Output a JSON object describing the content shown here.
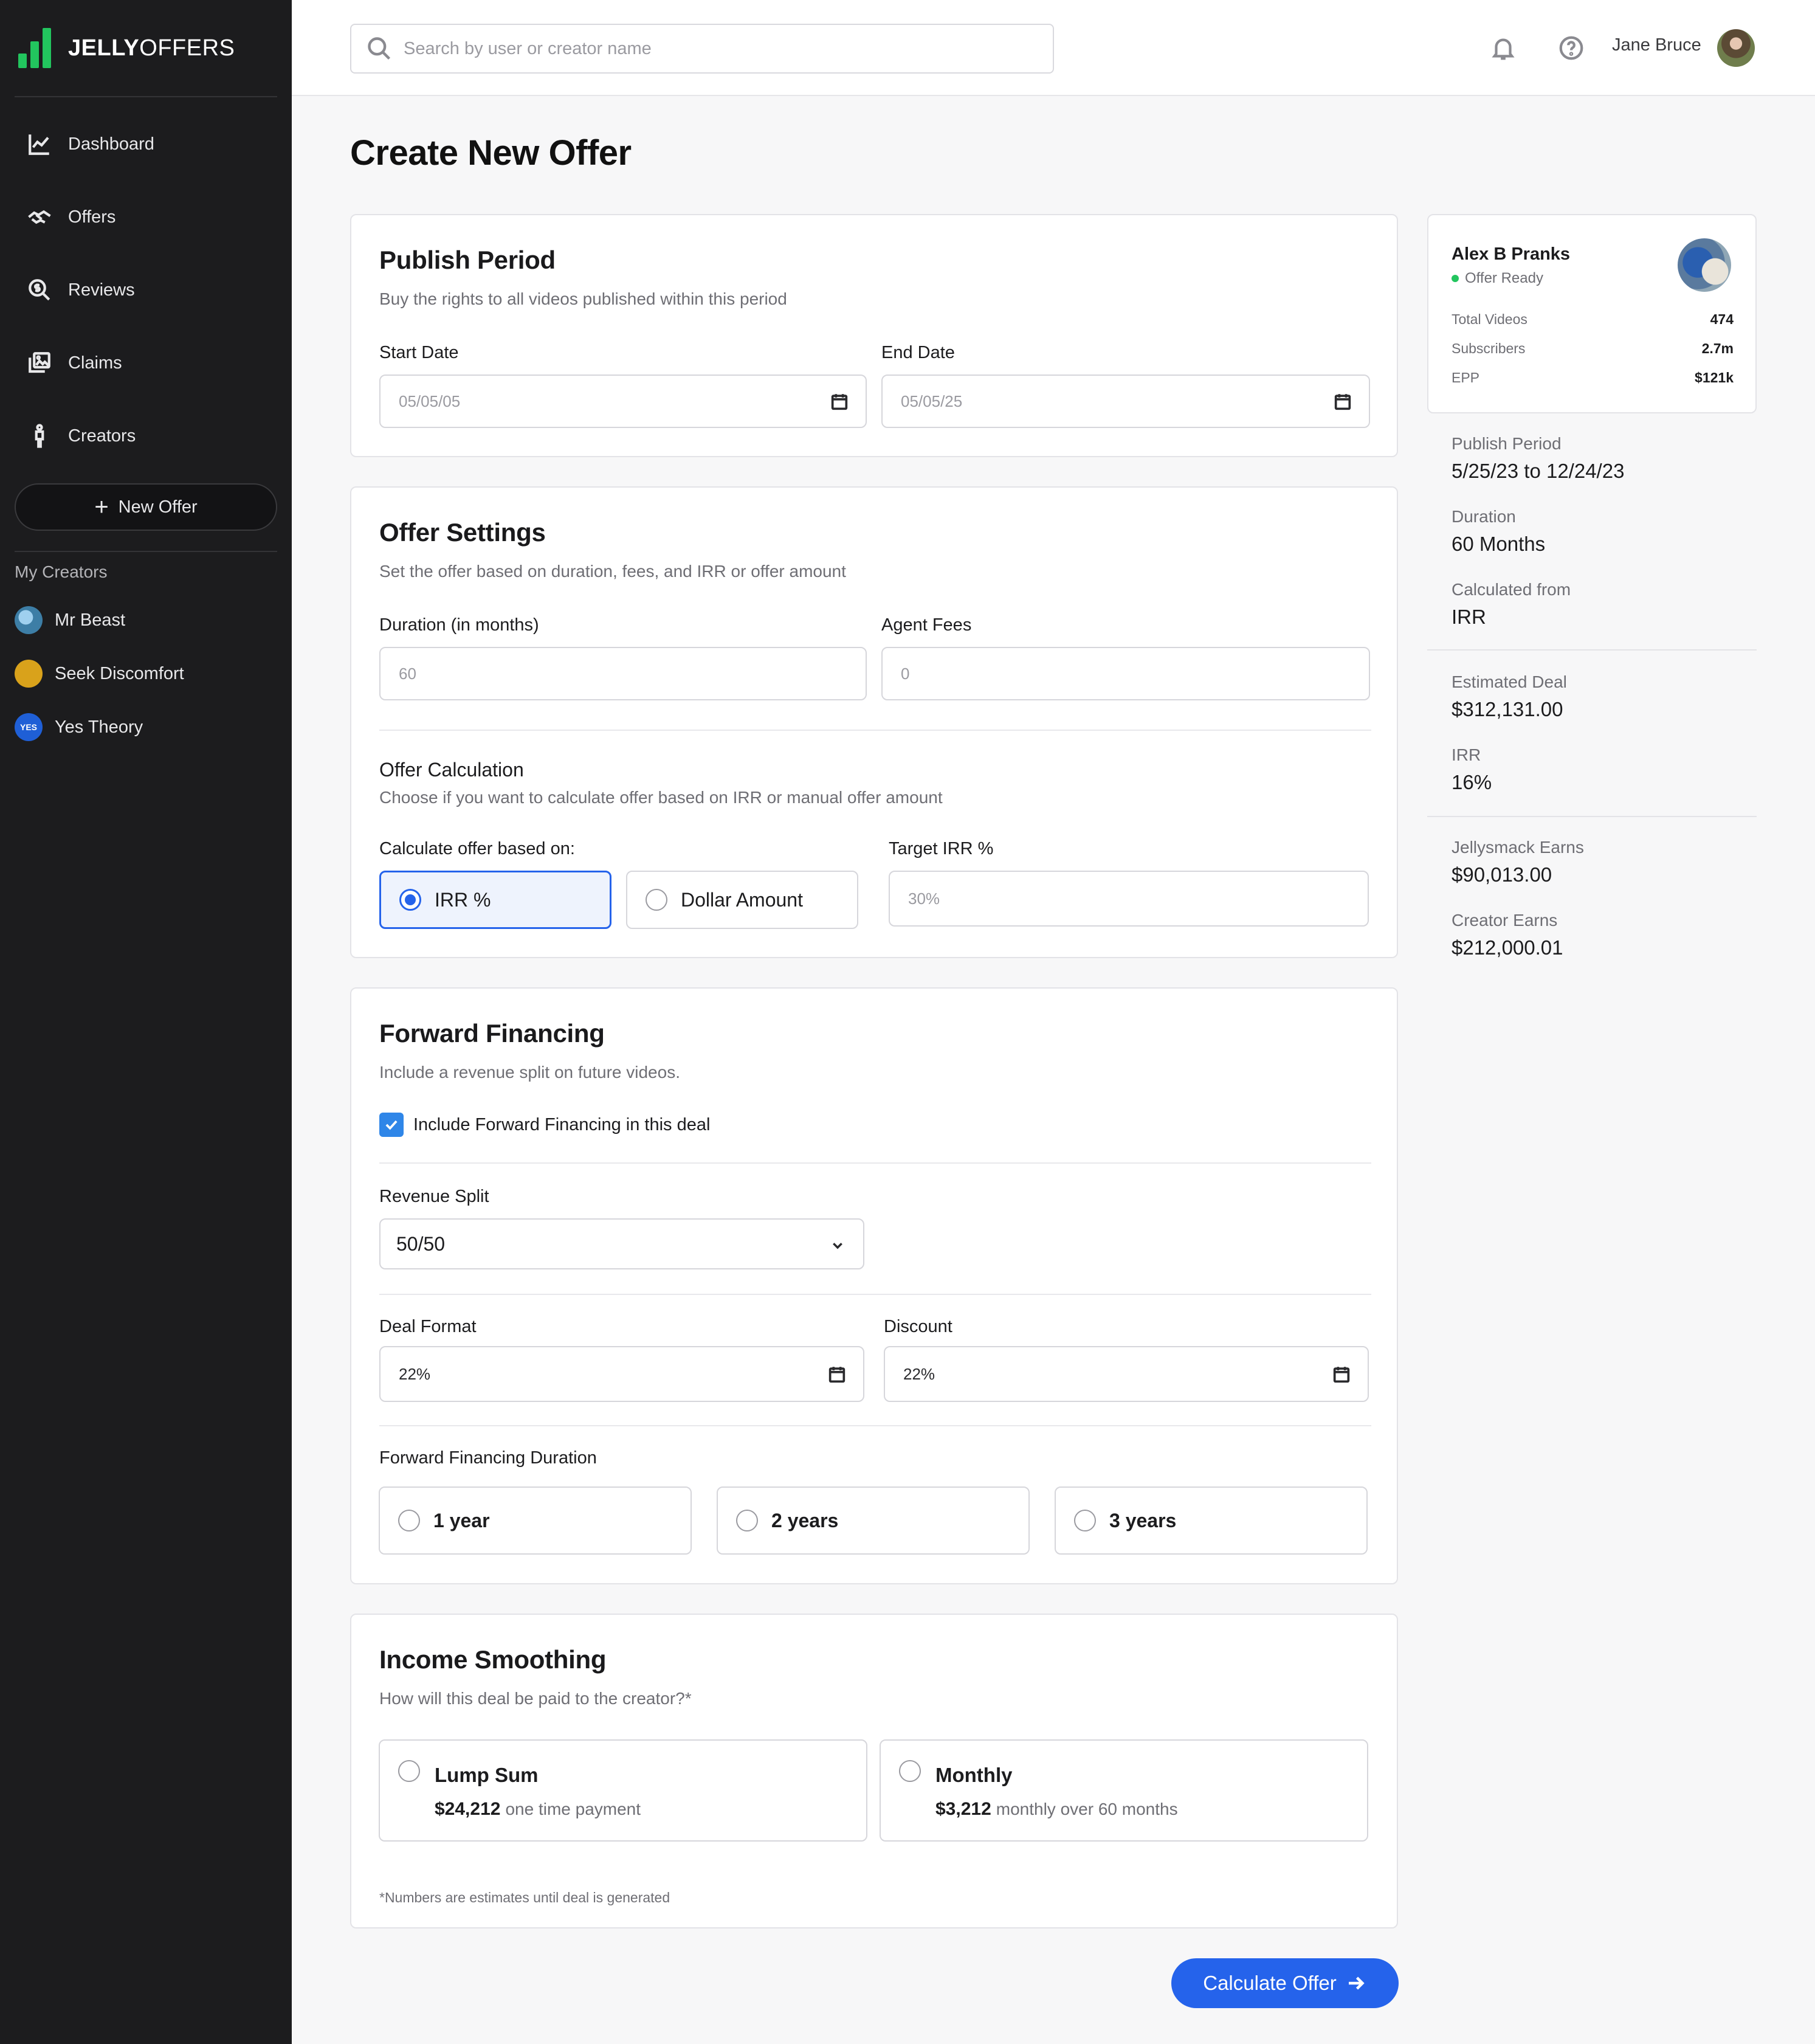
{
  "brand": {
    "name_bold": "JELLY",
    "name_light": "OFFERS",
    "accent": "#22c55e"
  },
  "sidebar": {
    "nav": [
      {
        "label": "Dashboard",
        "icon": "chart-line-icon"
      },
      {
        "label": "Offers",
        "icon": "handshake-icon"
      },
      {
        "label": "Reviews",
        "icon": "dollar-search-icon"
      },
      {
        "label": "Claims",
        "icon": "images-icon"
      },
      {
        "label": "Creators",
        "icon": "person-icon"
      }
    ],
    "new_offer_label": "New Offer",
    "my_creators_heading": "My Creators",
    "creators": [
      {
        "name": "Mr Beast",
        "avatar_color": "#3d7ea6"
      },
      {
        "name": "Seek Discomfort",
        "avatar_color": "#d9a21b"
      },
      {
        "name": "Yes Theory",
        "avatar_color": "#1f5fd6",
        "avatar_text": "YES"
      }
    ]
  },
  "header": {
    "search_placeholder": "Search by user or creator name",
    "user_name": "Jane Bruce"
  },
  "page": {
    "title": "Create New Offer",
    "publish_period": {
      "title": "Publish Period",
      "subtitle": "Buy the rights to all videos published within this period",
      "start_label": "Start Date",
      "start_value": "05/05/05",
      "end_label": "End Date",
      "end_value": "05/05/25"
    },
    "offer_settings": {
      "title": "Offer Settings",
      "subtitle": "Set the offer based on duration, fees, and IRR or offer amount",
      "duration_label": "Duration (in months)",
      "duration_value": "60",
      "fees_label": "Agent Fees",
      "fees_value": "0",
      "calc_title": "Offer Calculation",
      "calc_subtitle": "Choose if you want to calculate offer based on IRR or manual offer amount",
      "based_on_label": "Calculate offer based on:",
      "option_irr": "IRR %",
      "option_dollar": "Dollar Amount",
      "selected_option": "IRR %",
      "target_label": "Target IRR %",
      "target_value": "30%"
    },
    "forward_financing": {
      "title": "Forward Financing",
      "subtitle": "Include a revenue split on future videos.",
      "include_label": "Include Forward Financing in this deal",
      "include_checked": true,
      "split_label": "Revenue Split",
      "split_value": "50/50",
      "format_label": "Deal Format",
      "format_value": "22%",
      "discount_label": "Discount",
      "discount_value": "22%",
      "duration_label": "Forward Financing Duration",
      "durations": [
        "1 year",
        "2 years",
        "3 years"
      ]
    },
    "income_smoothing": {
      "title": "Income Smoothing",
      "subtitle": "How will this deal be paid to the creator?*",
      "lump_title": "Lump Sum",
      "lump_amount": "$24,212",
      "lump_desc": "one time payment",
      "monthly_title": "Monthly",
      "monthly_amount": "$3,212",
      "monthly_desc": "monthly over 60 months",
      "footnote": "*Numbers are estimates until deal is generated"
    },
    "calculate_label": "Calculate Offer"
  },
  "summary": {
    "creator_name": "Alex B Pranks",
    "status": "Offer Ready",
    "stats": [
      {
        "label": "Total Videos",
        "value": "474"
      },
      {
        "label": "Subscribers",
        "value": "2.7m"
      },
      {
        "label": "EPP",
        "value": "$121k"
      }
    ],
    "publish_period_label": "Publish Period",
    "publish_period_value": "5/25/23 to 12/24/23",
    "duration_label": "Duration",
    "duration_value": "60 Months",
    "calc_from_label": "Calculated from",
    "calc_from_value": "IRR",
    "est_deal_label": "Estimated Deal",
    "est_deal_value": "$312,131.00",
    "irr_label": "IRR",
    "irr_value": "16%",
    "jelly_label": "Jellysmack Earns",
    "jelly_value": "$90,013.00",
    "creator_label": "Creator Earns",
    "creator_value": "$212,000.01"
  }
}
